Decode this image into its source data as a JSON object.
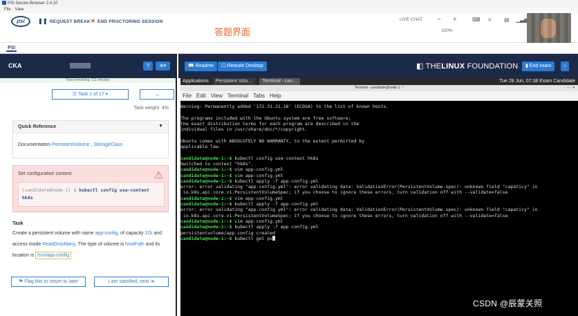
{
  "app": {
    "title": "PSI Secure Browser 2.4.10",
    "menu": [
      "File",
      "View"
    ]
  },
  "header": {
    "logo": "psi",
    "request_break": "REQUEST BREAK",
    "end_proctoring": "END PROCTORING SESSION",
    "center_label": "答题界面",
    "live_chat": "LIVE CHAT",
    "zoom": "100%",
    "zoom_out": "−",
    "zoom_in": "+"
  },
  "tab": {
    "label": "PSI"
  },
  "left": {
    "exam_name": "CKA",
    "help_icon": "?",
    "settings_icon": "⊕▾",
    "time_remaining": "Time remaining: 111 minutes",
    "task_nav": "☰ Task 1 of 17 ▾",
    "next": "→",
    "task_weight": "Task weight: 4%",
    "quick_ref": {
      "title": "Quick Reference",
      "prefix": "Documentation",
      "link1": "PersistentVolume",
      "sep": " , ",
      "link2": "StorageClass"
    },
    "context": {
      "title": "Set configuration context:",
      "prompt": "[candidate@node-1] $",
      "command": "kubectl config use-context hk8s"
    },
    "task": {
      "heading": "Task",
      "t1": "Create a persistent volume with name ",
      "name": "app-config",
      "t2": ", of capacity",
      "capacity": "1Gi",
      "t3": " and access mode ",
      "mode": "ReadOnlyMany",
      "t4": ". The type of volume is",
      "type": "hostPath",
      "t5": " and its location is ",
      "location": "/srv/app-config"
    },
    "flag_button": "⚑ Flag this to return to later",
    "satisfied_button": "I am satisfied, next ➜"
  },
  "right": {
    "readme": "📖 Readme",
    "remote_desktop": "🖵 Remote Desktop",
    "brand_a": "THE",
    "brand_b": "LINUX",
    "brand_c": " FOUNDATION",
    "end_exam": "End exam",
    "home_icon": "⌂"
  },
  "desktop": {
    "applications": "Applications",
    "firefox_tab": "Persistent Volu…",
    "terminal_tab": "Terminal - can…",
    "clock": "Tue 28 Jun, 07:38",
    "user": "Exam Candidate",
    "term_title": "Terminal - candidate@node-1: ~",
    "term_menu": [
      "File",
      "Edit",
      "View",
      "Terminal",
      "Tabs",
      "Help"
    ]
  },
  "terminal": {
    "prompt": "candidate@node-1:~$",
    "lines": [
      {
        "t": "Warning: Permanently added '172.31.21.16' (ECDSA) to the list of known hosts."
      },
      {
        "t": ""
      },
      {
        "t": "The programs included with the Ubuntu system are free software;"
      },
      {
        "t": "the exact distribution terms for each program are described in the"
      },
      {
        "t": "individual files in /usr/share/doc/*/copyright."
      },
      {
        "t": ""
      },
      {
        "t": "Ubuntu comes with ABSOLUTELY NO WARRANTY, to the extent permitted by"
      },
      {
        "t": "applicable law."
      },
      {
        "t": ""
      },
      {
        "p": true,
        "t": " kubectl config use-context hk8s"
      },
      {
        "t": "Switched to context \"hk8s\"."
      },
      {
        "p": true,
        "t": " vim app-config.yml"
      },
      {
        "p": true,
        "t": " vim app-config.yml"
      },
      {
        "p": true,
        "t": " kubectl apply -f app-config.yml"
      },
      {
        "t": "error: error validating \"app-config.yml\": error validating data: ValidationError(PersistentVolume.spec): unknown field \"capaticy\" in"
      },
      {
        "t": " io.k8s.api.core.v1.PersistentVolumeSpec; if you choose to ignore these errors, turn validation off with --validate=false"
      },
      {
        "p": true,
        "t": " vim app-config.yml"
      },
      {
        "p": true,
        "t": " kubectl apply -f app-config.yml"
      },
      {
        "t": "error: error validating \"app-config.yml\": error validating data: ValidationError(PersistentVolume.spec): unknown field \"capaticy\" in"
      },
      {
        "t": " io.k8s.api.core.v1.PersistentVolumeSpec; if you choose to ignore these errors, turn validation off with --validate=false"
      },
      {
        "p": true,
        "t": " vim app-config.yml"
      },
      {
        "p": true,
        "t": " kubectl apply -f app-config.yml"
      },
      {
        "t": "persistentvolume/app-config created"
      },
      {
        "p": true,
        "t": " kubectl get pv",
        "cursor": true
      }
    ]
  },
  "watermark": "CSDN @辰蒙关照"
}
